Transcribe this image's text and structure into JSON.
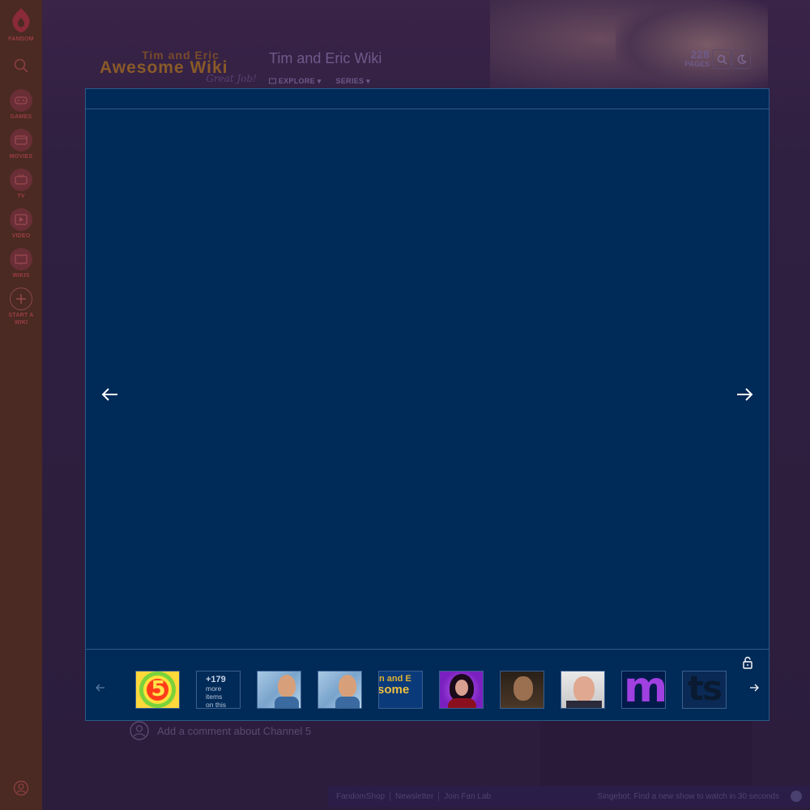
{
  "global_nav": {
    "logo_label": "FANDOM",
    "items": [
      {
        "label": "GAMES",
        "icon": "games-icon"
      },
      {
        "label": "MOVIES",
        "icon": "movies-icon"
      },
      {
        "label": "TV",
        "icon": "tv-icon"
      },
      {
        "label": "VIDEO",
        "icon": "video-icon"
      },
      {
        "label": "WIKIS",
        "icon": "wikis-icon"
      }
    ],
    "start_wiki_label": "START A WIKI"
  },
  "wiki_header": {
    "logo_line1": "Tim and Eric",
    "logo_line2": "Awesome Wiki",
    "logo_line3": "Great Job!",
    "title": "Tim and Eric Wiki",
    "nav": {
      "explore": "EXPLORE",
      "series": "SERIES"
    },
    "pages_count": "228",
    "pages_label": "PAGES"
  },
  "lightbox": {
    "more_items": {
      "count": "+179",
      "line1": "more",
      "line2": "items",
      "line3": "on this"
    }
  },
  "comments": {
    "placeholder": "Add a comment about Channel 5"
  },
  "footer": {
    "links": [
      "FandomShop",
      "Newsletter",
      "Join Fan Lab"
    ],
    "promo": "Singebot: Find a new show to watch in 30 seconds"
  },
  "colors": {
    "lightbox_bg": "#002a57",
    "nav_bg": "#4a2a22",
    "page_bg": "#2e1d40"
  }
}
